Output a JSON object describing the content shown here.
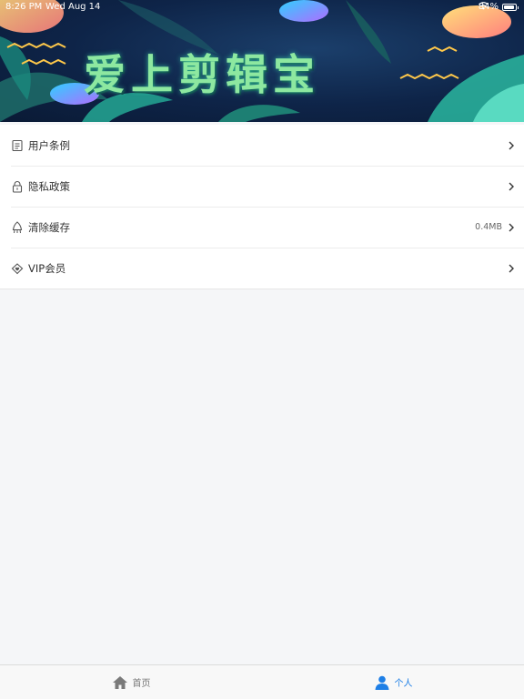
{
  "status_bar": {
    "time": "8:26 PM",
    "date": "Wed Aug 14",
    "battery": "84%"
  },
  "banner": {
    "title": "爱上剪辑宝"
  },
  "menu": {
    "items": [
      {
        "label": "用户条例",
        "icon": "document-icon",
        "value": ""
      },
      {
        "label": "隐私政策",
        "icon": "lock-icon",
        "value": ""
      },
      {
        "label": "清除缓存",
        "icon": "broom-icon",
        "value": "0.4MB"
      },
      {
        "label": "VIP会员",
        "icon": "diamond-heart-icon",
        "value": ""
      }
    ]
  },
  "tab_bar": {
    "tabs": [
      {
        "label": "首页",
        "icon": "home-icon",
        "active": false
      },
      {
        "label": "个人",
        "icon": "person-icon",
        "active": true
      }
    ]
  },
  "colors": {
    "accent": "#1e7fe6",
    "inactive_tab": "#777777",
    "background": "#f5f6f8"
  }
}
